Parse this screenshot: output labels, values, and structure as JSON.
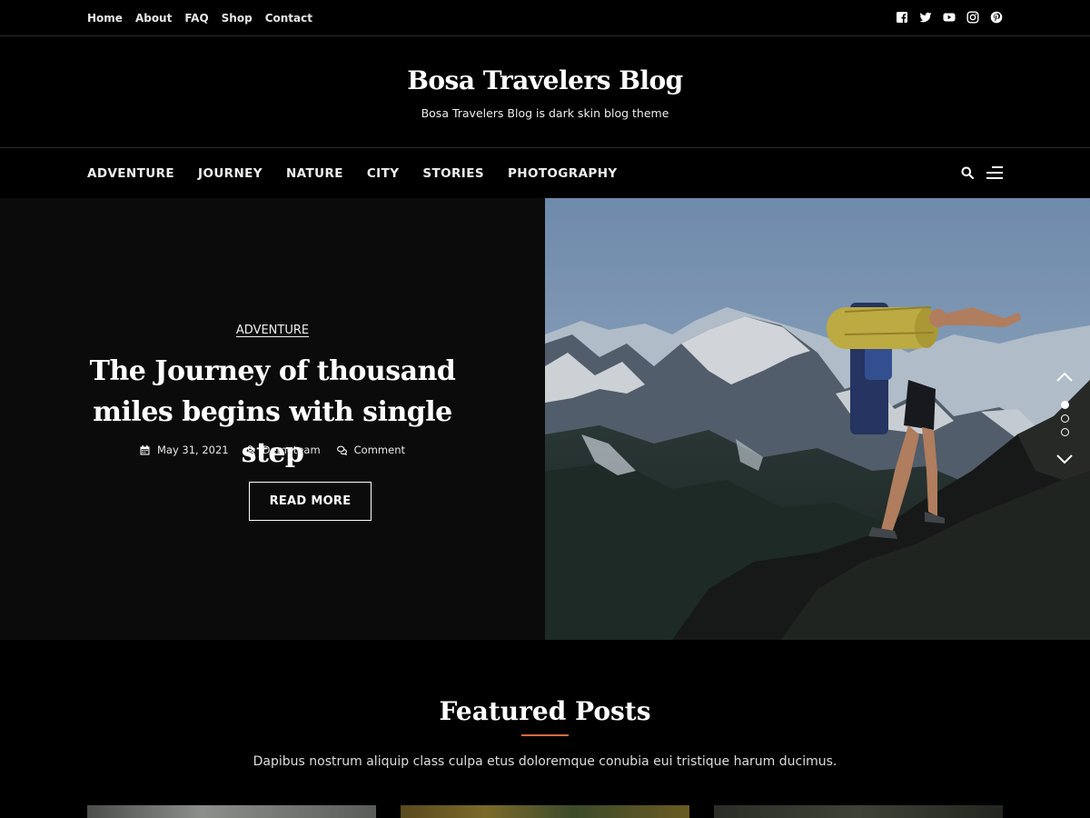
{
  "top_menu": [
    "Home",
    "About",
    "FAQ",
    "Shop",
    "Contact"
  ],
  "social_icons": [
    "facebook-icon",
    "twitter-icon",
    "youtube-icon",
    "instagram-icon",
    "pinterest-icon"
  ],
  "site": {
    "title": "Bosa Travelers Blog",
    "tagline": "Bosa Travelers Blog is dark skin blog theme"
  },
  "main_menu": [
    "ADVENTURE",
    "JOURNEY",
    "NATURE",
    "CITY",
    "STORIES",
    "PHOTOGRAPHY"
  ],
  "hero": {
    "category": "ADVENTURE",
    "title": "The Journey of thousand miles begins with single step",
    "date": "May 31, 2021",
    "author": "Demoteam",
    "comment": "Comment",
    "read_more": "READ MORE",
    "active_slide": 1,
    "slide_count": 3
  },
  "featured": {
    "title": "Featured Posts",
    "description": "Dapibus nostrum aliquip class culpa etus doloremque conubia eui tristique harum ducimus."
  },
  "colors": {
    "background": "#000000",
    "panel": "#0b0b0c",
    "accent": "#e06a3b"
  }
}
